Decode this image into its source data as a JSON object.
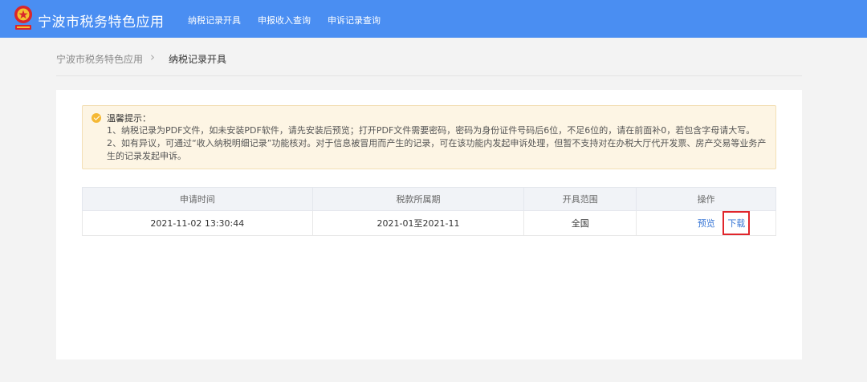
{
  "header": {
    "app_title": "宁波市税务特色应用",
    "nav": [
      {
        "label": "纳税记录开具"
      },
      {
        "label": "申报收入查询"
      },
      {
        "label": "申诉记录查询"
      }
    ]
  },
  "breadcrumb": {
    "home": "宁波市税务特色应用",
    "separator": "›",
    "current": "纳税记录开具"
  },
  "notice": {
    "title": "温馨提示：",
    "lines": [
      "1、纳税记录为PDF文件，如未安装PDF软件，请先安装后预览；打开PDF文件需要密码，密码为身份证件号码后6位，不足6位的，请在前面补0，若包含字母请大写。",
      "2、如有异议，可通过“收入纳税明细记录”功能核对。对于信息被冒用而产生的记录，可在该功能内发起申诉处理，但暂不支持对在办税大厅代开发票、房产交易等业务产生的记录发起申诉。"
    ]
  },
  "table": {
    "headers": [
      "申请时间",
      "税款所属期",
      "开具范围",
      "操作"
    ],
    "rows": [
      {
        "apply_time": "2021-11-02 13:30:44",
        "tax_period": "2021-01至2021-11",
        "scope": "全国",
        "preview": "预览",
        "download": "下载"
      }
    ]
  },
  "colors": {
    "header_bg": "#4a8ef2",
    "link": "#3a78d6",
    "highlight_box": "#e0252b",
    "notice_bg": "#fdf5e4",
    "notice_icon": "#f5b833"
  }
}
